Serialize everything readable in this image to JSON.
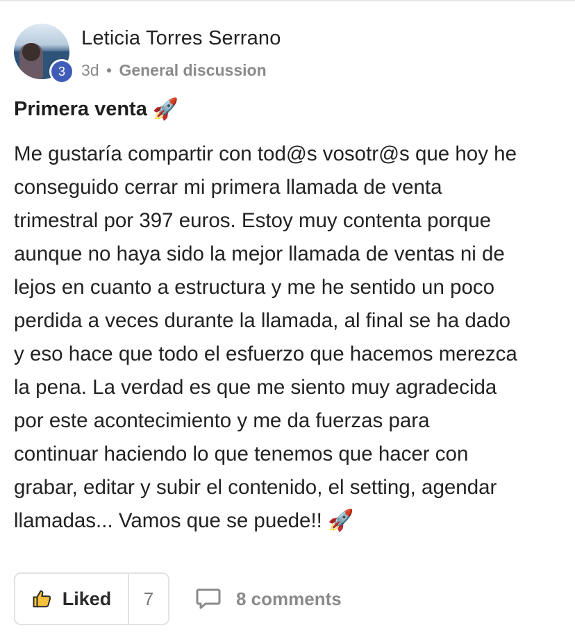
{
  "post": {
    "author": {
      "name": "Leticia Torres Serrano",
      "level": "3"
    },
    "meta": {
      "time": "3d",
      "separator": "•",
      "category": "General discussion"
    },
    "title": "Primera venta",
    "title_emoji": "🚀",
    "body_lines": [
      "Me gustaría compartir con tod@s vosotr@s que hoy he",
      "conseguido cerrar mi primera llamada de venta",
      "trimestral por 397 euros. Estoy muy contenta porque",
      "aunque no haya sido la mejor llamada de ventas ni de",
      "lejos en cuanto a estructura y me he sentido un poco",
      "perdida a veces durante la llamada, al final se ha dado",
      "y eso hace que todo el esfuerzo que hacemos merezca",
      "la pena. La verdad es que me siento muy agradecida",
      "por este acontecimiento y me da fuerzas para",
      "continuar haciendo lo que tenemos que hacer con",
      "grabar, editar y subir el contenido, el setting, agendar",
      "llamadas... Vamos que se puede!!"
    ],
    "body_end_emoji": "🚀"
  },
  "actions": {
    "like_label": "Liked",
    "like_count": "7",
    "comments_label": "8 comments",
    "icons": {
      "like": "thumbs-up-icon",
      "comments": "speech-bubble-icon"
    }
  },
  "colors": {
    "level_badge": "#3f5db8",
    "like_icon_fill": "#f5c33b",
    "muted_text": "#8a8a8a"
  }
}
